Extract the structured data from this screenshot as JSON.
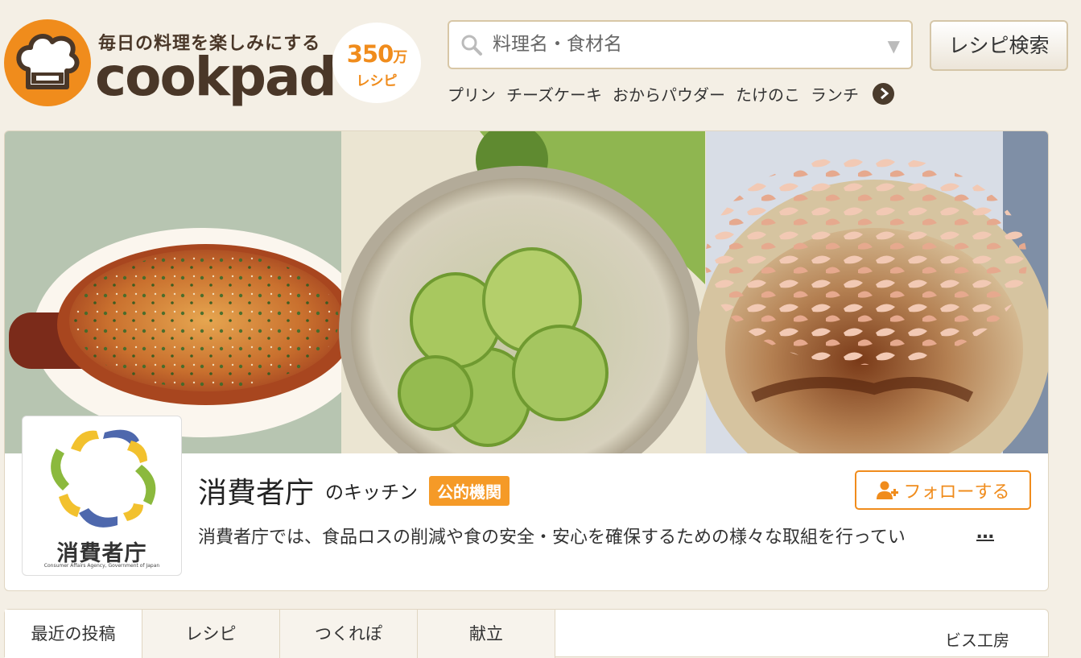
{
  "header": {
    "tagline": "毎日の料理を楽しみにする",
    "logo_word": "cookpad",
    "badge_number": "350",
    "badge_number_unit": "万",
    "badge_unit": "レシピ",
    "brand_color": "#f08c1c"
  },
  "search": {
    "placeholder": "料理名・食材名",
    "button_label": "レシピ検索",
    "keywords": [
      "プリン",
      "チーズケーキ",
      "おからパウダー",
      "たけのこ",
      "ランチ"
    ]
  },
  "kitchen": {
    "logo_text": "消費者庁",
    "logo_subtext": "Consumer Affairs Agency, Government of Japan",
    "name": "消費者庁",
    "suffix": "のキッチン",
    "badge": "公的機関",
    "follow_label": "フォローする",
    "description": "消費者庁では、食品ロスの削減や食の安全・安心を確保するための様々な取組を行ってい",
    "more_label": "…"
  },
  "tabs": [
    {
      "label": "最近の投稿",
      "active": true
    },
    {
      "label": "レシピ",
      "active": false
    },
    {
      "label": "つくれぽ",
      "active": false
    },
    {
      "label": "献立",
      "active": false
    }
  ],
  "tabs_right_text": "ビス工房"
}
